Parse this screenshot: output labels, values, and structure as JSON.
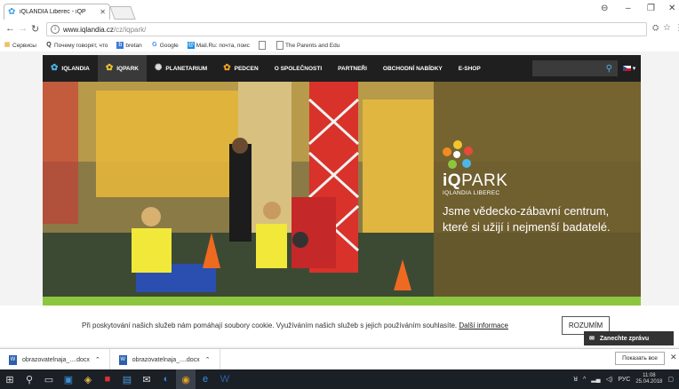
{
  "browser": {
    "tab_title": "iQLANDIA Liberec - iQP",
    "url_host": "www.iqlandia.cz",
    "url_path": "/cz/iqpark/",
    "bookmarks": [
      {
        "label": "Сервисы",
        "icon": "apps-grid-icon"
      },
      {
        "label": "Почему говорят, что",
        "icon": "search-q-icon"
      },
      {
        "label": "bretan",
        "icon": "bookmark-blue-icon"
      },
      {
        "label": "Google",
        "icon": "google-g-icon"
      },
      {
        "label": "Mail.Ru: почта, поис",
        "icon": "mailru-icon"
      },
      {
        "label": "",
        "icon": "page-icon"
      },
      {
        "label": "The Parents and Edu",
        "icon": "page-icon"
      }
    ]
  },
  "site_nav": {
    "items": [
      {
        "label": "IQLANDIA",
        "icon": "iqlandia-flower-icon",
        "active": false
      },
      {
        "label": "IQPARK",
        "icon": "iqpark-flower-icon",
        "active": true
      },
      {
        "label": "PLANETARIUM",
        "icon": "planetarium-icon",
        "active": false
      },
      {
        "label": "PEDCEN",
        "icon": "pedcen-icon",
        "active": false
      },
      {
        "label": "O SPOLEČNOSTI",
        "icon": "",
        "active": false
      },
      {
        "label": "PARTNEŘI",
        "icon": "",
        "active": false
      },
      {
        "label": "OBCHODNÍ NABÍDKY",
        "icon": "",
        "active": false
      },
      {
        "label": "E-SHOP",
        "icon": "",
        "active": false
      }
    ]
  },
  "hero": {
    "brand_prefix": "iQ",
    "brand_name": "PARK",
    "brand_sub": "IQLANDIA LIBEREC",
    "tagline_line1": "Jsme vědecko-zábavní centrum,",
    "tagline_line2": "které si užijí i nejmenší badatelé."
  },
  "cookie": {
    "text": "Při poskytování našich služeb nám pomáhají soubory cookie. Využíváním našich služeb s jejich používáním souhlasíte.",
    "link": "Další informace",
    "button": "ROZUMÍM"
  },
  "chat": {
    "label": "Zanechte zprávu"
  },
  "downloads": {
    "items": [
      "obrazovatelnaja_....docx",
      "obrazovatelnaja_....docx"
    ],
    "show_all": "Показать все"
  },
  "taskbar": {
    "lang": "РУС",
    "time": "11:08",
    "date": "25.04.2018"
  },
  "colors": {
    "nav_bg": "#1f1f1f",
    "accent_green": "#8cc63f",
    "accent_blue": "#4bb6e8"
  }
}
